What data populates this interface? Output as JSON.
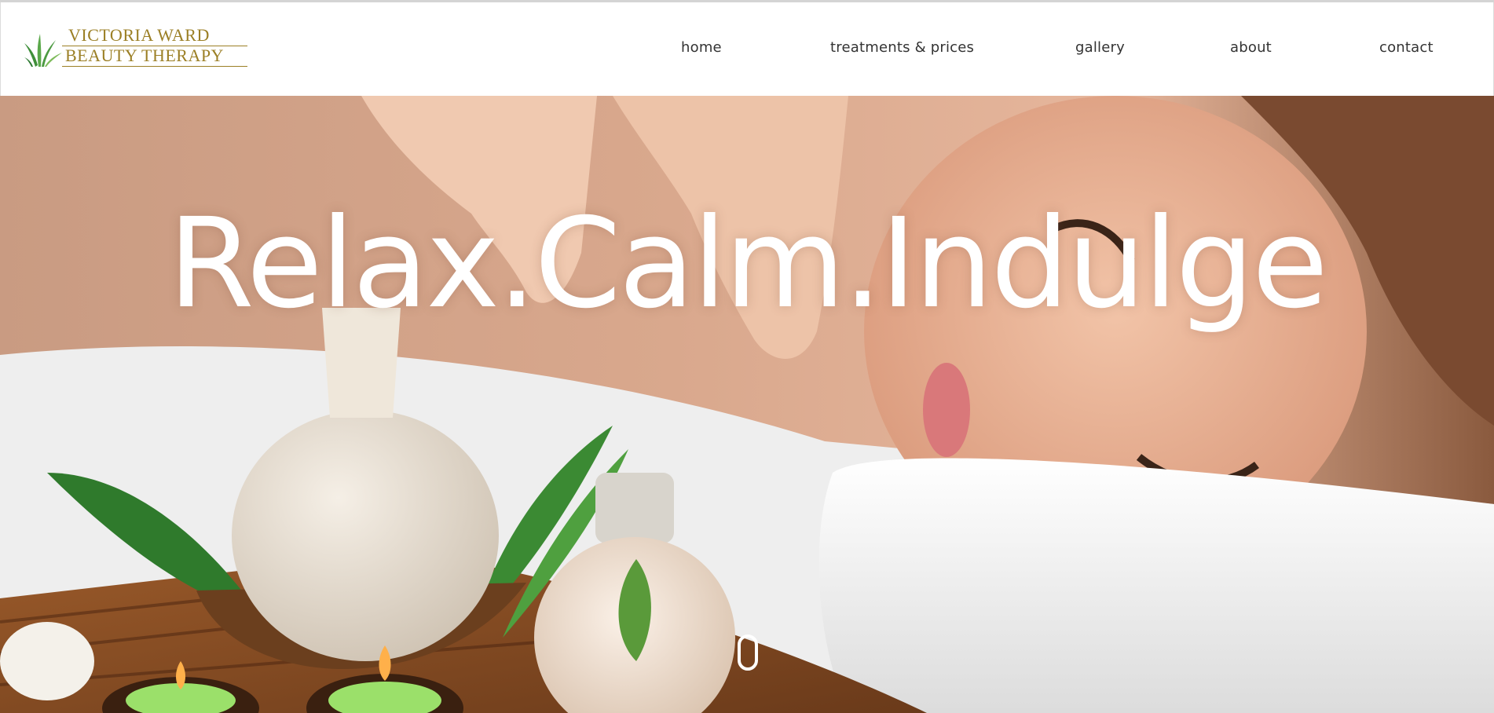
{
  "brand": {
    "line1": "VICTORIA WARD",
    "line2": "BEAUTY THERAPY",
    "logo_icon": "grass-leaves-icon",
    "color": "#9b7f25"
  },
  "nav": {
    "items": [
      {
        "label": "home"
      },
      {
        "label": "treatments & prices"
      },
      {
        "label": "gallery"
      },
      {
        "label": "about"
      },
      {
        "label": "contact"
      }
    ]
  },
  "hero": {
    "headline": "Relax.Calm.Indulge",
    "scroll_icon": "mouse-scroll-icon",
    "image_subject": "spa-massage-photo"
  },
  "colors": {
    "nav_text": "#333333",
    "headline": "#ffffff"
  }
}
